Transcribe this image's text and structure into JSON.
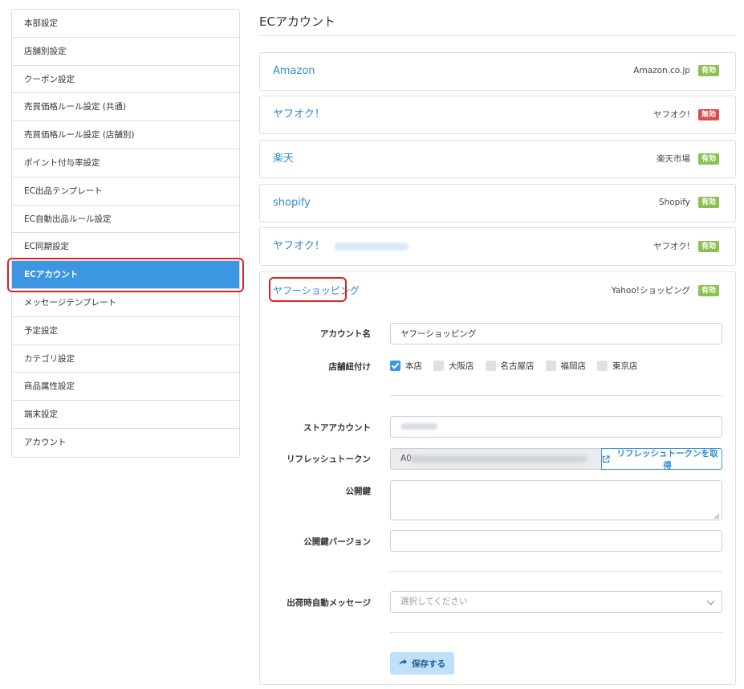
{
  "sidebar": {
    "items": [
      {
        "label": "本部設定"
      },
      {
        "label": "店舗別設定"
      },
      {
        "label": "クーポン設定"
      },
      {
        "label": "売買価格ルール設定 (共通)"
      },
      {
        "label": "売買価格ルール設定 (店舗別)"
      },
      {
        "label": "ポイント付与率設定"
      },
      {
        "label": "EC出品テンプレート"
      },
      {
        "label": "EC自動出品ルール設定"
      },
      {
        "label": "EC同期設定"
      },
      {
        "label": "ECアカウント"
      },
      {
        "label": "メッセージテンプレート"
      },
      {
        "label": "予定設定"
      },
      {
        "label": "カテゴリ設定"
      },
      {
        "label": "商品属性設定"
      },
      {
        "label": "端末設定"
      },
      {
        "label": "アカウント"
      }
    ],
    "active_index": 9,
    "active_color": "#3c96e2"
  },
  "page": {
    "title": "ECアカウント"
  },
  "accounts": [
    {
      "name": "Amazon",
      "platform": "Amazon.co.jp",
      "status": "有効"
    },
    {
      "name": "ヤフオク！",
      "platform": "ヤフオク!",
      "status": "無効"
    },
    {
      "name": "楽天",
      "platform": "楽天市場",
      "status": "有効"
    },
    {
      "name": "shopify",
      "platform": "Shopify",
      "status": "有効"
    },
    {
      "name": "ヤフオク！",
      "platform": "ヤフオク!",
      "status": "有効"
    },
    {
      "name": "ヤフーショッピング",
      "platform": "Yahoo!ショッピング",
      "status": "有効"
    }
  ],
  "status_colors": {
    "enabled": "#8cc152",
    "disabled": "#e04b4b"
  },
  "form": {
    "account_name_label": "アカウント名",
    "account_name_value": "ヤフーショッピング",
    "stores_label": "店舗紐付け",
    "stores": [
      {
        "name": "本店",
        "checked": true
      },
      {
        "name": "大阪店",
        "checked": false
      },
      {
        "name": "名古屋店",
        "checked": false
      },
      {
        "name": "福岡店",
        "checked": false
      },
      {
        "name": "東京店",
        "checked": false
      }
    ],
    "store_account_label": "ストアアカウント",
    "refresh_token_label": "リフレッシュトークン",
    "refresh_token_prefix": "A0",
    "get_token_button": "リフレッシュトークンを取得",
    "public_key_label": "公開鍵",
    "public_key_version_label": "公開鍵バージョン",
    "auto_message_label": "出荷時自動メッセージ",
    "auto_message_placeholder": "選択してください",
    "save_button": "保存する"
  }
}
